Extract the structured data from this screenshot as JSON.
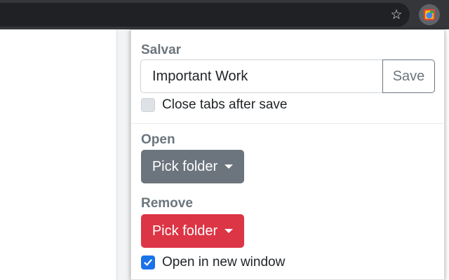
{
  "browser": {
    "bookmark_icon": "star-outline-icon",
    "extension_icon": "extension-logo-icon"
  },
  "popup": {
    "save_section": {
      "title": "Salvar",
      "name_value": "Important Work",
      "save_label": "Save",
      "close_tabs_label": "Close tabs after save",
      "close_tabs_checked": false
    },
    "open_section": {
      "title": "Open",
      "pick_label": "Pick folder",
      "button_color": "#6c757d"
    },
    "remove_section": {
      "title": "Remove",
      "pick_label": "Pick folder",
      "button_color": "#dc3545"
    },
    "new_window": {
      "label": "Open in new window",
      "checked": true
    }
  },
  "colors": {
    "check_accent": "#1a73e8",
    "section_title": "#6c757d"
  }
}
